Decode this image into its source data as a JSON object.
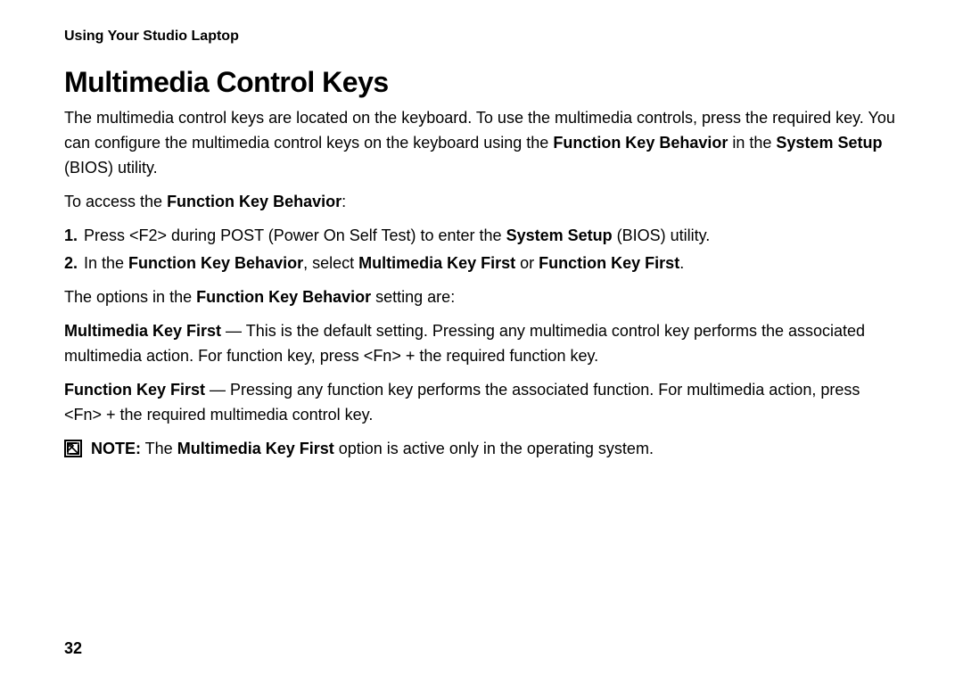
{
  "header": "Using Your Studio Laptop",
  "title": "Multimedia Control Keys",
  "intro": {
    "t1": "The multimedia control keys are located on the keyboard. To use the multimedia controls, press the required key. You can configure the multimedia control keys on the keyboard using the ",
    "b1": "Function Key Behavior",
    "t2": " in the ",
    "b2": "System Setup",
    "t3": " (BIOS) utility."
  },
  "access": {
    "t1": "To access the ",
    "b1": "Function Key Behavior",
    "t2": ":"
  },
  "steps": [
    {
      "num": "1.",
      "t1": "Press <F2> during POST (Power On Self Test) to enter the ",
      "b1": "System Setup",
      "t2": " (BIOS) utility."
    },
    {
      "num": "2.",
      "t1": "In the ",
      "b1": "Function Key Behavior",
      "t2": ", select ",
      "b2": "Multimedia Key First",
      "t3": " or ",
      "b3": "Function Key First",
      "t4": "."
    }
  ],
  "options_intro": {
    "t1": "The options in the ",
    "b1": "Function Key Behavior",
    "t2": " setting are:"
  },
  "opt_mm": {
    "b1": "Multimedia Key First",
    "t1": " — This is the default setting. Pressing any multimedia control key performs the associated multimedia action. For function key, press <Fn> + the required function key."
  },
  "opt_fn": {
    "b1": "Function Key First",
    "t1": " — Pressing any function key performs the associated function. For multimedia action, press <Fn> + the required multimedia control key."
  },
  "note": {
    "b1": "NOTE:",
    "t1": " The ",
    "b2": "Multimedia Key First",
    "t2": " option is active only in the operating system."
  },
  "page_number": "32"
}
